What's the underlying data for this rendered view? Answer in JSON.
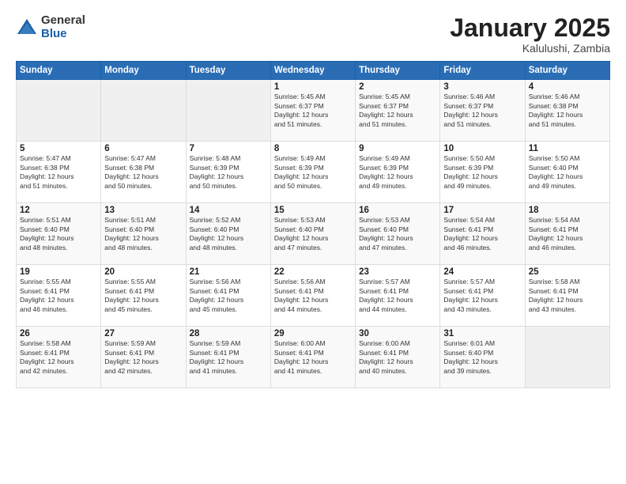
{
  "logo": {
    "general": "General",
    "blue": "Blue"
  },
  "title": "January 2025",
  "location": "Kalulushi, Zambia",
  "days_header": [
    "Sunday",
    "Monday",
    "Tuesday",
    "Wednesday",
    "Thursday",
    "Friday",
    "Saturday"
  ],
  "weeks": [
    [
      {
        "day": "",
        "info": ""
      },
      {
        "day": "",
        "info": ""
      },
      {
        "day": "",
        "info": ""
      },
      {
        "day": "1",
        "info": "Sunrise: 5:45 AM\nSunset: 6:37 PM\nDaylight: 12 hours\nand 51 minutes."
      },
      {
        "day": "2",
        "info": "Sunrise: 5:45 AM\nSunset: 6:37 PM\nDaylight: 12 hours\nand 51 minutes."
      },
      {
        "day": "3",
        "info": "Sunrise: 5:46 AM\nSunset: 6:37 PM\nDaylight: 12 hours\nand 51 minutes."
      },
      {
        "day": "4",
        "info": "Sunrise: 5:46 AM\nSunset: 6:38 PM\nDaylight: 12 hours\nand 51 minutes."
      }
    ],
    [
      {
        "day": "5",
        "info": "Sunrise: 5:47 AM\nSunset: 6:38 PM\nDaylight: 12 hours\nand 51 minutes."
      },
      {
        "day": "6",
        "info": "Sunrise: 5:47 AM\nSunset: 6:38 PM\nDaylight: 12 hours\nand 50 minutes."
      },
      {
        "day": "7",
        "info": "Sunrise: 5:48 AM\nSunset: 6:39 PM\nDaylight: 12 hours\nand 50 minutes."
      },
      {
        "day": "8",
        "info": "Sunrise: 5:49 AM\nSunset: 6:39 PM\nDaylight: 12 hours\nand 50 minutes."
      },
      {
        "day": "9",
        "info": "Sunrise: 5:49 AM\nSunset: 6:39 PM\nDaylight: 12 hours\nand 49 minutes."
      },
      {
        "day": "10",
        "info": "Sunrise: 5:50 AM\nSunset: 6:39 PM\nDaylight: 12 hours\nand 49 minutes."
      },
      {
        "day": "11",
        "info": "Sunrise: 5:50 AM\nSunset: 6:40 PM\nDaylight: 12 hours\nand 49 minutes."
      }
    ],
    [
      {
        "day": "12",
        "info": "Sunrise: 5:51 AM\nSunset: 6:40 PM\nDaylight: 12 hours\nand 48 minutes."
      },
      {
        "day": "13",
        "info": "Sunrise: 5:51 AM\nSunset: 6:40 PM\nDaylight: 12 hours\nand 48 minutes."
      },
      {
        "day": "14",
        "info": "Sunrise: 5:52 AM\nSunset: 6:40 PM\nDaylight: 12 hours\nand 48 minutes."
      },
      {
        "day": "15",
        "info": "Sunrise: 5:53 AM\nSunset: 6:40 PM\nDaylight: 12 hours\nand 47 minutes."
      },
      {
        "day": "16",
        "info": "Sunrise: 5:53 AM\nSunset: 6:40 PM\nDaylight: 12 hours\nand 47 minutes."
      },
      {
        "day": "17",
        "info": "Sunrise: 5:54 AM\nSunset: 6:41 PM\nDaylight: 12 hours\nand 46 minutes."
      },
      {
        "day": "18",
        "info": "Sunrise: 5:54 AM\nSunset: 6:41 PM\nDaylight: 12 hours\nand 46 minutes."
      }
    ],
    [
      {
        "day": "19",
        "info": "Sunrise: 5:55 AM\nSunset: 6:41 PM\nDaylight: 12 hours\nand 46 minutes."
      },
      {
        "day": "20",
        "info": "Sunrise: 5:55 AM\nSunset: 6:41 PM\nDaylight: 12 hours\nand 45 minutes."
      },
      {
        "day": "21",
        "info": "Sunrise: 5:56 AM\nSunset: 6:41 PM\nDaylight: 12 hours\nand 45 minutes."
      },
      {
        "day": "22",
        "info": "Sunrise: 5:56 AM\nSunset: 6:41 PM\nDaylight: 12 hours\nand 44 minutes."
      },
      {
        "day": "23",
        "info": "Sunrise: 5:57 AM\nSunset: 6:41 PM\nDaylight: 12 hours\nand 44 minutes."
      },
      {
        "day": "24",
        "info": "Sunrise: 5:57 AM\nSunset: 6:41 PM\nDaylight: 12 hours\nand 43 minutes."
      },
      {
        "day": "25",
        "info": "Sunrise: 5:58 AM\nSunset: 6:41 PM\nDaylight: 12 hours\nand 43 minutes."
      }
    ],
    [
      {
        "day": "26",
        "info": "Sunrise: 5:58 AM\nSunset: 6:41 PM\nDaylight: 12 hours\nand 42 minutes."
      },
      {
        "day": "27",
        "info": "Sunrise: 5:59 AM\nSunset: 6:41 PM\nDaylight: 12 hours\nand 42 minutes."
      },
      {
        "day": "28",
        "info": "Sunrise: 5:59 AM\nSunset: 6:41 PM\nDaylight: 12 hours\nand 41 minutes."
      },
      {
        "day": "29",
        "info": "Sunrise: 6:00 AM\nSunset: 6:41 PM\nDaylight: 12 hours\nand 41 minutes."
      },
      {
        "day": "30",
        "info": "Sunrise: 6:00 AM\nSunset: 6:41 PM\nDaylight: 12 hours\nand 40 minutes."
      },
      {
        "day": "31",
        "info": "Sunrise: 6:01 AM\nSunset: 6:40 PM\nDaylight: 12 hours\nand 39 minutes."
      },
      {
        "day": "",
        "info": ""
      }
    ]
  ]
}
